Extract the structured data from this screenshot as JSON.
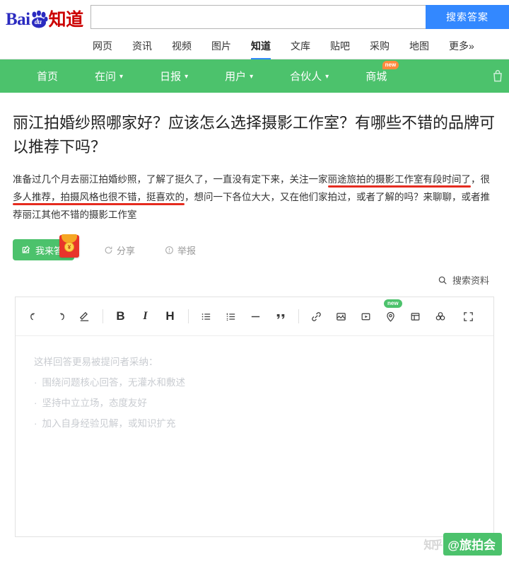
{
  "header": {
    "logo": {
      "bai": "Bai",
      "du": "du",
      "zhidao": "知道"
    },
    "search": {
      "value": "",
      "placeholder": "",
      "button_label": "搜索答案"
    }
  },
  "tabs": [
    {
      "label": "网页",
      "active": false
    },
    {
      "label": "资讯",
      "active": false
    },
    {
      "label": "视频",
      "active": false
    },
    {
      "label": "图片",
      "active": false
    },
    {
      "label": "知道",
      "active": true
    },
    {
      "label": "文库",
      "active": false
    },
    {
      "label": "贴吧",
      "active": false
    },
    {
      "label": "采购",
      "active": false
    },
    {
      "label": "地图",
      "active": false
    },
    {
      "label": "更多»",
      "active": false
    }
  ],
  "greennav": {
    "items": [
      {
        "label": "首页",
        "caret": false,
        "badge": ""
      },
      {
        "label": "在问",
        "caret": true,
        "badge": ""
      },
      {
        "label": "日报",
        "caret": true,
        "badge": ""
      },
      {
        "label": "用户",
        "caret": true,
        "badge": ""
      },
      {
        "label": "合伙人",
        "caret": true,
        "badge": ""
      },
      {
        "label": "商城",
        "caret": false,
        "badge": "new"
      }
    ],
    "cart_icon": "shopping-bag-icon",
    "background": "#4cc26c"
  },
  "question": {
    "title": "丽江拍婚纱照哪家好？应该怎么选择摄影工作室？有哪些不错的品牌可以推荐下吗？",
    "body_part1": "准备过几个月去丽江拍婚纱照，了解了挺久了，一直没有定下来，关注一家",
    "body_underline1": "丽途旅拍的摄影工作室有段时间了",
    "body_part2": "，很",
    "body_underline2": "多人推荐，拍摄风格也很不错，挺喜欢的",
    "body_part3": "，想问一下各位大大，又在他们家拍过，或者了解的吗？来聊聊，或者推荐丽江其他不错的摄影工作室",
    "underline_color": "#e52b1f"
  },
  "actions": {
    "answer_label": "我来答",
    "answer_icon": "pencil-square-icon",
    "envelope_icon": "red-envelope-icon",
    "envelope_coin_text": "¥",
    "share_label": "分享",
    "share_icon": "share-icon",
    "report_label": "举报",
    "report_icon": "warning-circle-icon",
    "search_material_label": "搜索资料",
    "search_material_icon": "search-icon"
  },
  "editor": {
    "toolbar": [
      {
        "name": "undo-icon",
        "glyph": "undo",
        "badge": ""
      },
      {
        "name": "redo-icon",
        "glyph": "redo",
        "badge": ""
      },
      {
        "name": "eraser-icon",
        "glyph": "eraser",
        "badge": ""
      },
      {
        "name": "bold-button",
        "glyph": "B",
        "badge": ""
      },
      {
        "name": "italic-button",
        "glyph": "I",
        "badge": ""
      },
      {
        "name": "heading-button",
        "glyph": "H",
        "badge": ""
      },
      {
        "name": "bullet-list-icon",
        "glyph": "ul",
        "badge": ""
      },
      {
        "name": "ordered-list-icon",
        "glyph": "ol",
        "badge": ""
      },
      {
        "name": "horizontal-rule-icon",
        "glyph": "hr",
        "badge": ""
      },
      {
        "name": "quote-icon",
        "glyph": "quote",
        "badge": ""
      },
      {
        "name": "link-icon",
        "glyph": "link",
        "badge": ""
      },
      {
        "name": "image-icon",
        "glyph": "image",
        "badge": ""
      },
      {
        "name": "video-icon",
        "glyph": "video",
        "badge": ""
      },
      {
        "name": "location-icon",
        "glyph": "location",
        "badge": "new"
      },
      {
        "name": "table-icon",
        "glyph": "table",
        "badge": ""
      },
      {
        "name": "formula-icon",
        "glyph": "formula",
        "badge": ""
      }
    ],
    "expand_icon": "fullscreen-icon",
    "placeholder": {
      "title": "这样回答更易被提问者采纳：",
      "bullets": [
        "围绕问题核心回答，无灌水和敷述",
        "坚持中立立场，态度友好",
        "加入自身经验见解，或知识扩充"
      ]
    }
  },
  "watermark": {
    "faint_text": "知乎",
    "green_text": "@旅拍会",
    "green_color": "#4cc26c"
  }
}
